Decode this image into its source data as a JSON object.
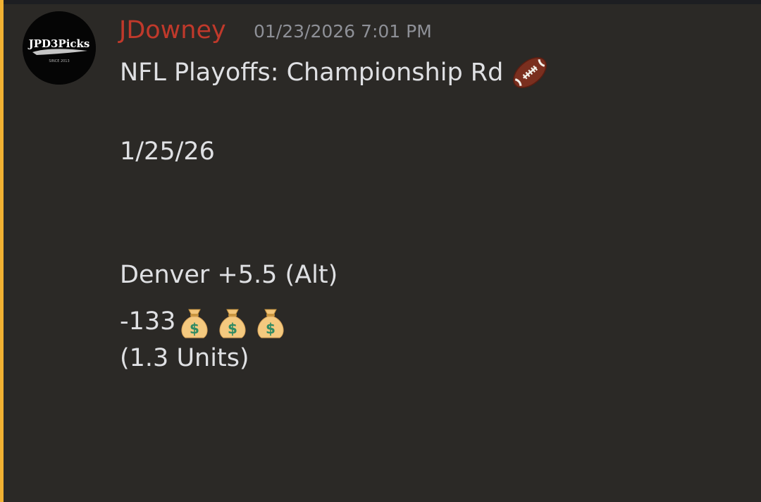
{
  "message": {
    "avatar": {
      "text": "JPD3Picks",
      "subtext": "SINCE 2013",
      "icon": "jpd3picks-logo"
    },
    "author": {
      "name": "JDowney",
      "name_color": "#c0392b"
    },
    "timestamp": "01/23/2026 7:01 PM",
    "content": {
      "line1": "NFL Playoffs: Championship Rd",
      "line1_emoji": "football-icon",
      "line2": "1/25/26",
      "line3": "Denver +5.5 (Alt)",
      "line4": "-133",
      "line4_emojis": [
        "money-bag-icon",
        "money-bag-icon",
        "money-bag-icon"
      ],
      "line5": "(1.3 Units)"
    }
  },
  "theme": {
    "background": "#2b2926",
    "highlight_bar": "#f0b132",
    "text": "#dfe0e3",
    "timestamp": "#8e9097"
  }
}
